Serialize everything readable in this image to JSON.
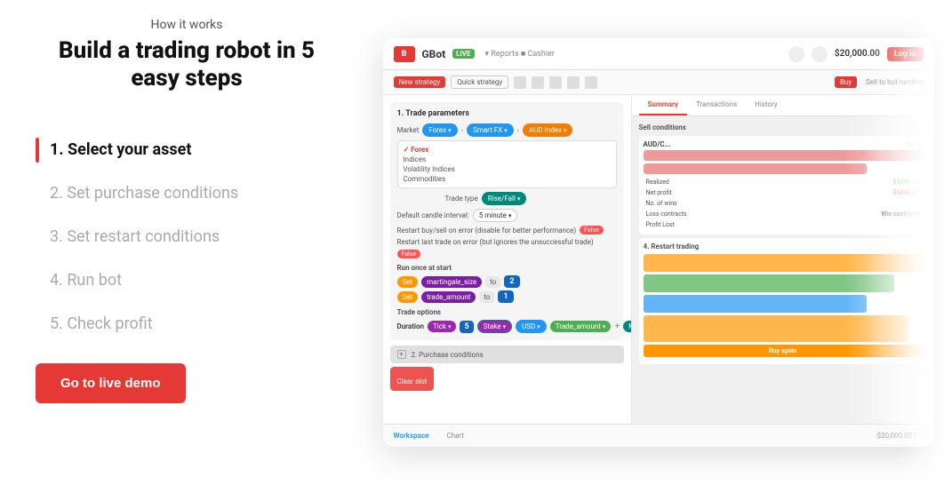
{
  "header": {
    "how_it_works": "How it works",
    "title": "Build a trading robot in 5 easy steps"
  },
  "steps": [
    {
      "id": 1,
      "label": "1. Select your asset",
      "active": true
    },
    {
      "id": 2,
      "label": "2. Set purchase conditions",
      "active": false
    },
    {
      "id": 3,
      "label": "3. Set restart conditions",
      "active": false
    },
    {
      "id": 4,
      "label": "4. Run bot",
      "active": false
    },
    {
      "id": 5,
      "label": "5. Check profit",
      "active": false
    }
  ],
  "cta": {
    "label": "Go to live demo"
  },
  "mockup": {
    "topbar": {
      "logo": "B",
      "brand": "GBot",
      "badge": "LIVE",
      "balance": "$20,000.00",
      "btn": "Log in"
    },
    "subbar": {
      "btn1": "New strategy",
      "btn2": "Quick strategy",
      "btn3": "Buy"
    },
    "tabs": [
      "Summary",
      "Transactions",
      "History"
    ],
    "section_title": "1. Trade parameters",
    "market_label": "Market",
    "forex_label": "Forex",
    "smart_fx_label": "Smart FX",
    "aud_label": "AUD Index",
    "forex_items": [
      "Forex",
      "Indices",
      "Volatility Indices",
      "Commodities"
    ],
    "default_candle": "Default candle interval:",
    "candle_val": "5 minute",
    "restart_error": "Restart buy/sell on error (disable for better performance)",
    "restart_val": "False",
    "restart_last": "Restart last trade on error (but ignores the unsuccessful trade)",
    "restart_last_val": "False",
    "run_once": "Run once at start",
    "set1_var": "martingale_size",
    "set1_to": "to",
    "set1_val": "2",
    "set2_var": "trade_amount",
    "set2_to": "to",
    "set2_val": "1",
    "trade_options": "Trade options",
    "duration_label": "Duration",
    "tick_label": "Tick",
    "tick_num": "5",
    "stake_label": "Stake",
    "usd_label": "USD",
    "trade_amount_label": "Trade_amount",
    "martindale_label": "Martingale_size",
    "collapsed1": "2. Purchase conditions",
    "collapsed2": "Clear slot",
    "sell_conditions_title": "Sell conditions",
    "sell_pair": "AUD/C",
    "restart_section_title": "4. Restart trading",
    "bottombar": [
      "Workspace",
      "Chart"
    ]
  }
}
